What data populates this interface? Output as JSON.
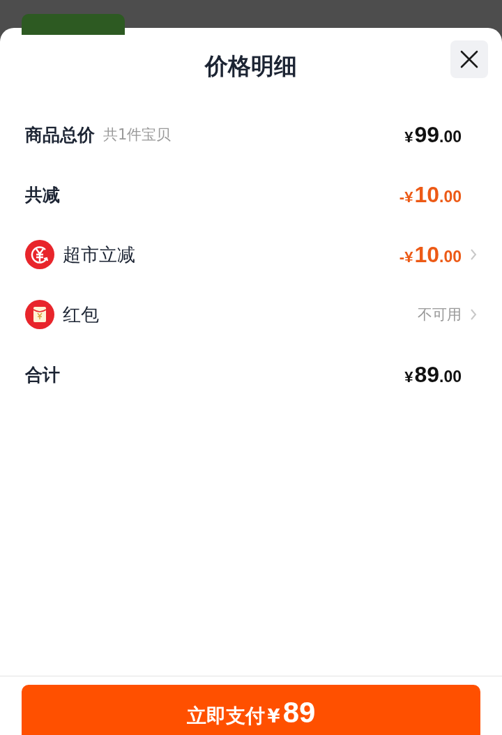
{
  "sheet": {
    "title": "价格明细"
  },
  "rows": [
    {
      "kind": "subtotal",
      "label": "商品总价",
      "note": "共1件宝贝",
      "discount": false,
      "amount": {
        "prefix": "¥",
        "whole": "99",
        "cents": ".00"
      }
    },
    {
      "kind": "summary",
      "label": "共减",
      "discount": true,
      "amount": {
        "prefix": "-¥",
        "whole": "10",
        "cents": ".00"
      }
    },
    {
      "kind": "coupon",
      "label": "超市立减",
      "discount": true,
      "amount": {
        "prefix": "-¥",
        "whole": "10",
        "cents": ".00"
      }
    },
    {
      "kind": "hongbao",
      "label": "红包",
      "status": "不可用"
    },
    {
      "kind": "summary",
      "label": "合计",
      "discount": false,
      "amount": {
        "prefix": "¥",
        "whole": "89",
        "cents": ".00"
      }
    }
  ],
  "pay_button": {
    "label": "立即支付",
    "currency": "¥",
    "amount": "89"
  }
}
